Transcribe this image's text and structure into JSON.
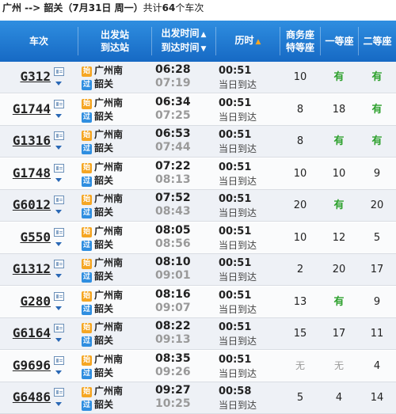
{
  "title": {
    "route": "广州 --> 韶关",
    "date": "（7月31日  周一）",
    "count_prefix": "共计",
    "count": "64",
    "count_suffix": "个车次"
  },
  "header": {
    "train": "车次",
    "station_from": "出发站",
    "station_to": "到达站",
    "time_dep": "出发时间",
    "time_arr": "到达时间",
    "duration": "历时",
    "business_1": "商务座",
    "business_2": "特等座",
    "first": "一等座",
    "second": "二等座",
    "sort_up": "▲",
    "sort_down": "▼"
  },
  "badges": {
    "start": "始",
    "pass": "过"
  },
  "rows": [
    {
      "no": "G312",
      "from": "广州南",
      "to": "韶关",
      "from_badge": "始",
      "to_badge": "过",
      "dep": "06:28",
      "arr": "07:19",
      "dur": "00:51",
      "arr_day": "当日到达",
      "biz": "10",
      "first": "有",
      "second": "有"
    },
    {
      "no": "G1744",
      "from": "广州南",
      "to": "韶关",
      "from_badge": "始",
      "to_badge": "过",
      "dep": "06:34",
      "arr": "07:25",
      "dur": "00:51",
      "arr_day": "当日到达",
      "biz": "8",
      "first": "18",
      "second": "有"
    },
    {
      "no": "G1316",
      "from": "广州南",
      "to": "韶关",
      "from_badge": "始",
      "to_badge": "过",
      "dep": "06:53",
      "arr": "07:44",
      "dur": "00:51",
      "arr_day": "当日到达",
      "biz": "8",
      "first": "有",
      "second": "有"
    },
    {
      "no": "G1748",
      "from": "广州南",
      "to": "韶关",
      "from_badge": "始",
      "to_badge": "过",
      "dep": "07:22",
      "arr": "08:13",
      "dur": "00:51",
      "arr_day": "当日到达",
      "biz": "10",
      "first": "10",
      "second": "9"
    },
    {
      "no": "G6012",
      "from": "广州南",
      "to": "韶关",
      "from_badge": "始",
      "to_badge": "过",
      "dep": "07:52",
      "arr": "08:43",
      "dur": "00:51",
      "arr_day": "当日到达",
      "biz": "20",
      "first": "有",
      "second": "20"
    },
    {
      "no": "G550",
      "from": "广州南",
      "to": "韶关",
      "from_badge": "始",
      "to_badge": "过",
      "dep": "08:05",
      "arr": "08:56",
      "dur": "00:51",
      "arr_day": "当日到达",
      "biz": "10",
      "first": "12",
      "second": "5"
    },
    {
      "no": "G1312",
      "from": "广州南",
      "to": "韶关",
      "from_badge": "始",
      "to_badge": "过",
      "dep": "08:10",
      "arr": "09:01",
      "dur": "00:51",
      "arr_day": "当日到达",
      "biz": "2",
      "first": "20",
      "second": "17"
    },
    {
      "no": "G280",
      "from": "广州南",
      "to": "韶关",
      "from_badge": "始",
      "to_badge": "过",
      "dep": "08:16",
      "arr": "09:07",
      "dur": "00:51",
      "arr_day": "当日到达",
      "biz": "13",
      "first": "有",
      "second": "9"
    },
    {
      "no": "G6164",
      "from": "广州南",
      "to": "韶关",
      "from_badge": "始",
      "to_badge": "过",
      "dep": "08:22",
      "arr": "09:13",
      "dur": "00:51",
      "arr_day": "当日到达",
      "biz": "15",
      "first": "17",
      "second": "11"
    },
    {
      "no": "G9696",
      "from": "广州南",
      "to": "韶关",
      "from_badge": "始",
      "to_badge": "过",
      "dep": "08:35",
      "arr": "09:26",
      "dur": "00:51",
      "arr_day": "当日到达",
      "biz": "无",
      "first": "无",
      "second": "4"
    },
    {
      "no": "G6486",
      "from": "广州南",
      "to": "韶关",
      "from_badge": "始",
      "to_badge": "过",
      "dep": "09:27",
      "arr": "10:25",
      "dur": "00:58",
      "arr_day": "当日到达",
      "biz": "5",
      "first": "4",
      "second": "14"
    }
  ],
  "colors": {
    "header_top": "#2f8ee0",
    "header_bottom": "#1669c4",
    "available": "#2ea12e",
    "start_badge": "#f5a623",
    "pass_badge": "#2f8ee0",
    "sort_active": "#f5a623"
  }
}
